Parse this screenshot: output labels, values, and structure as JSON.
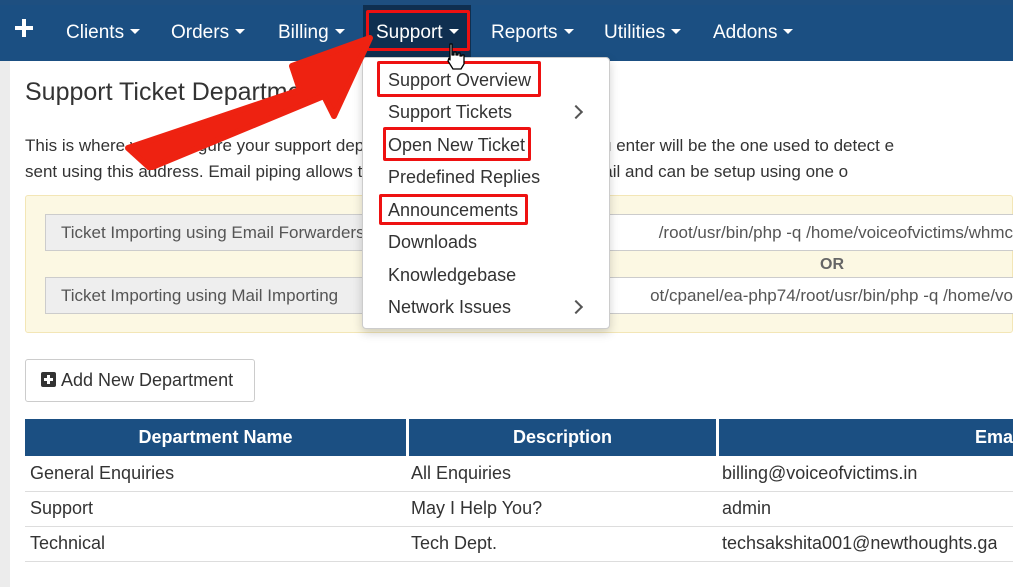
{
  "nav": {
    "items": [
      {
        "label": "Clients"
      },
      {
        "label": "Orders"
      },
      {
        "label": "Billing"
      },
      {
        "label": "Support"
      },
      {
        "label": "Reports"
      },
      {
        "label": "Utilities"
      },
      {
        "label": "Addons"
      }
    ]
  },
  "page": {
    "title": "Support Ticket Departments",
    "intro_line1": "This is where you configure your support departments. The email address you enter will be the one used to detect e",
    "intro_line2": "sent using this address. Email piping allows tickets to be responded to by email and can be setup using one o"
  },
  "import": {
    "forward_label": "Ticket Importing using Email Forwarders",
    "forward_value": "/root/usr/bin/php -q /home/voiceofvictims/whmc",
    "or_label": "OR",
    "mail_label": "Ticket Importing using Mail Importing",
    "mail_value": "ot/cpanel/ea-php74/root/usr/bin/php -q /home/vo"
  },
  "add_button": {
    "label": "Add New Department"
  },
  "table": {
    "headers": [
      "Department Name",
      "Description",
      "Ema"
    ],
    "rows": [
      [
        "General Enquiries",
        "All Enquiries",
        "billing@voiceofvictims.in"
      ],
      [
        "Support",
        "May I Help You?",
        "admin"
      ],
      [
        "Technical",
        "Tech Dept.",
        "techsakshita001@newthoughts.ga"
      ]
    ]
  },
  "dropdown": {
    "items": [
      {
        "label": "Support Overview"
      },
      {
        "label": "Support Tickets"
      },
      {
        "label": "Open New Ticket"
      },
      {
        "label": "Predefined Replies"
      },
      {
        "label": "Announcements"
      },
      {
        "label": "Downloads"
      },
      {
        "label": "Knowledgebase"
      },
      {
        "label": "Network Issues"
      }
    ]
  },
  "colors": {
    "navbar": "#1b4f82",
    "nav_active": "#0f2f50",
    "highlight_red": "#e11111",
    "panel_bg": "#fcf8e3"
  }
}
